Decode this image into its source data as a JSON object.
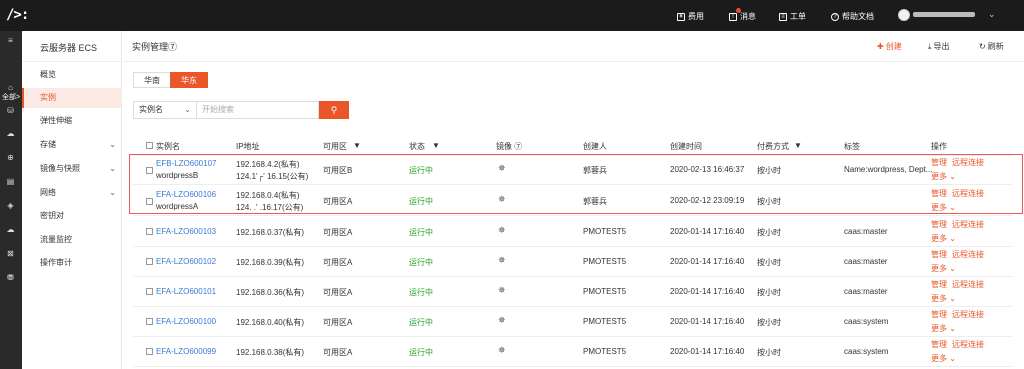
{
  "topbar": {
    "logo": "/>:",
    "billing": "费用",
    "messages": "消息",
    "tickets": "工单",
    "docs": "帮助文档",
    "user_caret": "⌄"
  },
  "iconbar": {
    "all": "全部>"
  },
  "sidebar": {
    "title": "云服务器 ECS",
    "items": [
      {
        "label": "概览",
        "active": false,
        "arrow": false
      },
      {
        "label": "实例",
        "active": true,
        "arrow": false
      },
      {
        "label": "弹性伸缩",
        "active": false,
        "arrow": false
      },
      {
        "label": "存储",
        "active": false,
        "arrow": true
      },
      {
        "label": "镜像与快照",
        "active": false,
        "arrow": true
      },
      {
        "label": "网络",
        "active": false,
        "arrow": true
      },
      {
        "label": "密钥对",
        "active": false,
        "arrow": false
      },
      {
        "label": "流量监控",
        "active": false,
        "arrow": false
      },
      {
        "label": "操作审计",
        "active": false,
        "arrow": false
      }
    ]
  },
  "main": {
    "breadcrumb": "实例管理⑦",
    "create": "创建",
    "export": "导出",
    "refresh": "刷新",
    "regions": [
      "华南",
      "华东"
    ],
    "filter_select": "实例名",
    "search_placeholder": "开始搜索"
  },
  "table": {
    "columns": [
      "实例名",
      "IP地址",
      "可用区",
      "状态",
      "镜像 ⑦",
      "创建人",
      "创建时间",
      "付费方式",
      "标签",
      "操作"
    ],
    "manage": "管理",
    "remote": "远程连接",
    "more": "更多",
    "rows": [
      {
        "id": "EFB-LZO600107",
        "name": "wordpressB",
        "ip1": "192.168.4.2(私有)",
        "ip2": "124.1'┌' 16.15(公有)",
        "zone": "可用区B",
        "status": "运行中",
        "creator": "郭蓉兵",
        "created": "2020-02-13 16:46:37",
        "billing": "按小时",
        "tag": "Name:wordpress, Dept..."
      },
      {
        "id": "EFA-LZO600106",
        "name": "wordpressA",
        "ip1": "192.168.0.4(私有)",
        "ip2": "124.  .' .16.17(公有)",
        "zone": "可用区A",
        "status": "运行中",
        "creator": "郭蓉兵",
        "created": "2020-02-12 23:09:19",
        "billing": "按小时",
        "tag": ""
      },
      {
        "id": "EFA-LZO600103",
        "name": "",
        "ip1": "192.168.0.37(私有)",
        "ip2": "",
        "zone": "可用区A",
        "status": "运行中",
        "creator": "PMOTEST5",
        "created": "2020-01-14 17:16:40",
        "billing": "按小时",
        "tag": "caas:master"
      },
      {
        "id": "EFA-LZO600102",
        "name": "",
        "ip1": "192.168.0.39(私有)",
        "ip2": "",
        "zone": "可用区A",
        "status": "运行中",
        "creator": "PMOTEST5",
        "created": "2020-01-14 17:16:40",
        "billing": "按小时",
        "tag": "caas:master"
      },
      {
        "id": "EFA-LZO600101",
        "name": "",
        "ip1": "192.168.0.36(私有)",
        "ip2": "",
        "zone": "可用区A",
        "status": "运行中",
        "creator": "PMOTEST5",
        "created": "2020-01-14 17:16:40",
        "billing": "按小时",
        "tag": "caas:master"
      },
      {
        "id": "EFA-LZO600100",
        "name": "",
        "ip1": "192.168.0.40(私有)",
        "ip2": "",
        "zone": "可用区A",
        "status": "运行中",
        "creator": "PMOTEST5",
        "created": "2020-01-14 17:16:40",
        "billing": "按小时",
        "tag": "caas:system"
      },
      {
        "id": "EFA-LZO600099",
        "name": "",
        "ip1": "192.168.0.38(私有)",
        "ip2": "",
        "zone": "可用区A",
        "status": "运行中",
        "creator": "PMOTEST5",
        "created": "2020-01-14 17:16:40",
        "billing": "按小时",
        "tag": "caas:system"
      }
    ]
  },
  "colors": {
    "accent": "#e8562a",
    "link": "#3a7bd5",
    "running": "#2aa12a",
    "topbar": "#1b1b1b"
  }
}
